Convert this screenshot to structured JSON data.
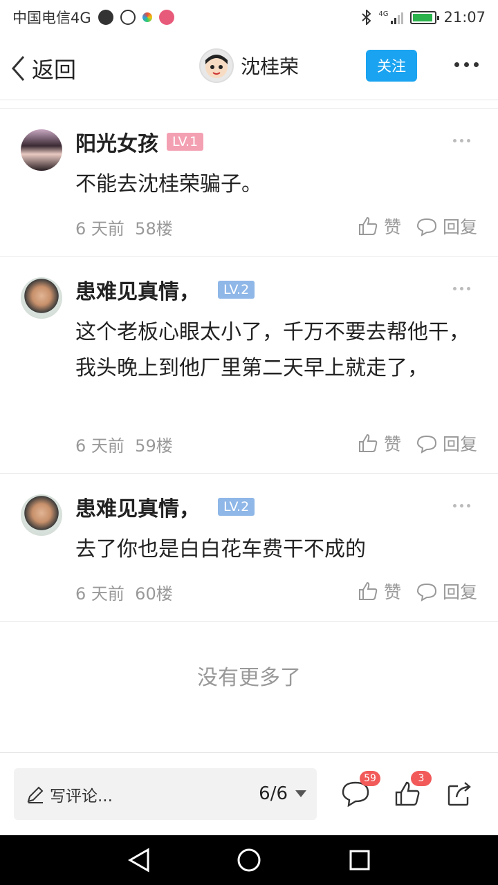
{
  "status_bar": {
    "carrier": "中国电信4G",
    "time": "21:07",
    "network": "4G",
    "colors": {
      "battery_fill": "#2bb24c"
    }
  },
  "header": {
    "back_label": "返回",
    "title": "沈桂荣",
    "follow_label": "关注"
  },
  "comments": [
    {
      "name": "阳光女孩",
      "level": "LV.1",
      "text": "不能去沈桂荣骗子。",
      "time": "6 天前",
      "floor": "58楼",
      "like_label": "赞",
      "reply_label": "回复"
    },
    {
      "name": "患难见真情，",
      "level": "LV.2",
      "text": "这个老板心眼太小了，千万不要去帮他干，我头晚上到他厂里第二天早上就走了，",
      "time": "6 天前",
      "floor": "59楼",
      "like_label": "赞",
      "reply_label": "回复"
    },
    {
      "name": "患难见真情，",
      "level": "LV.2",
      "text": "去了你也是白白花车费干不成的",
      "time": "6 天前",
      "floor": "60楼",
      "like_label": "赞",
      "reply_label": "回复"
    }
  ],
  "footer_message": "没有更多了",
  "toolbar": {
    "write_placeholder": "写评论...",
    "page_indicator": "6/6",
    "comment_count": "59",
    "like_count": "3"
  },
  "colors": {
    "accent": "#1aa3f0",
    "lv1": "#f4a0b3",
    "lv2": "#8fb7e8",
    "badge": "#f25a5a"
  }
}
